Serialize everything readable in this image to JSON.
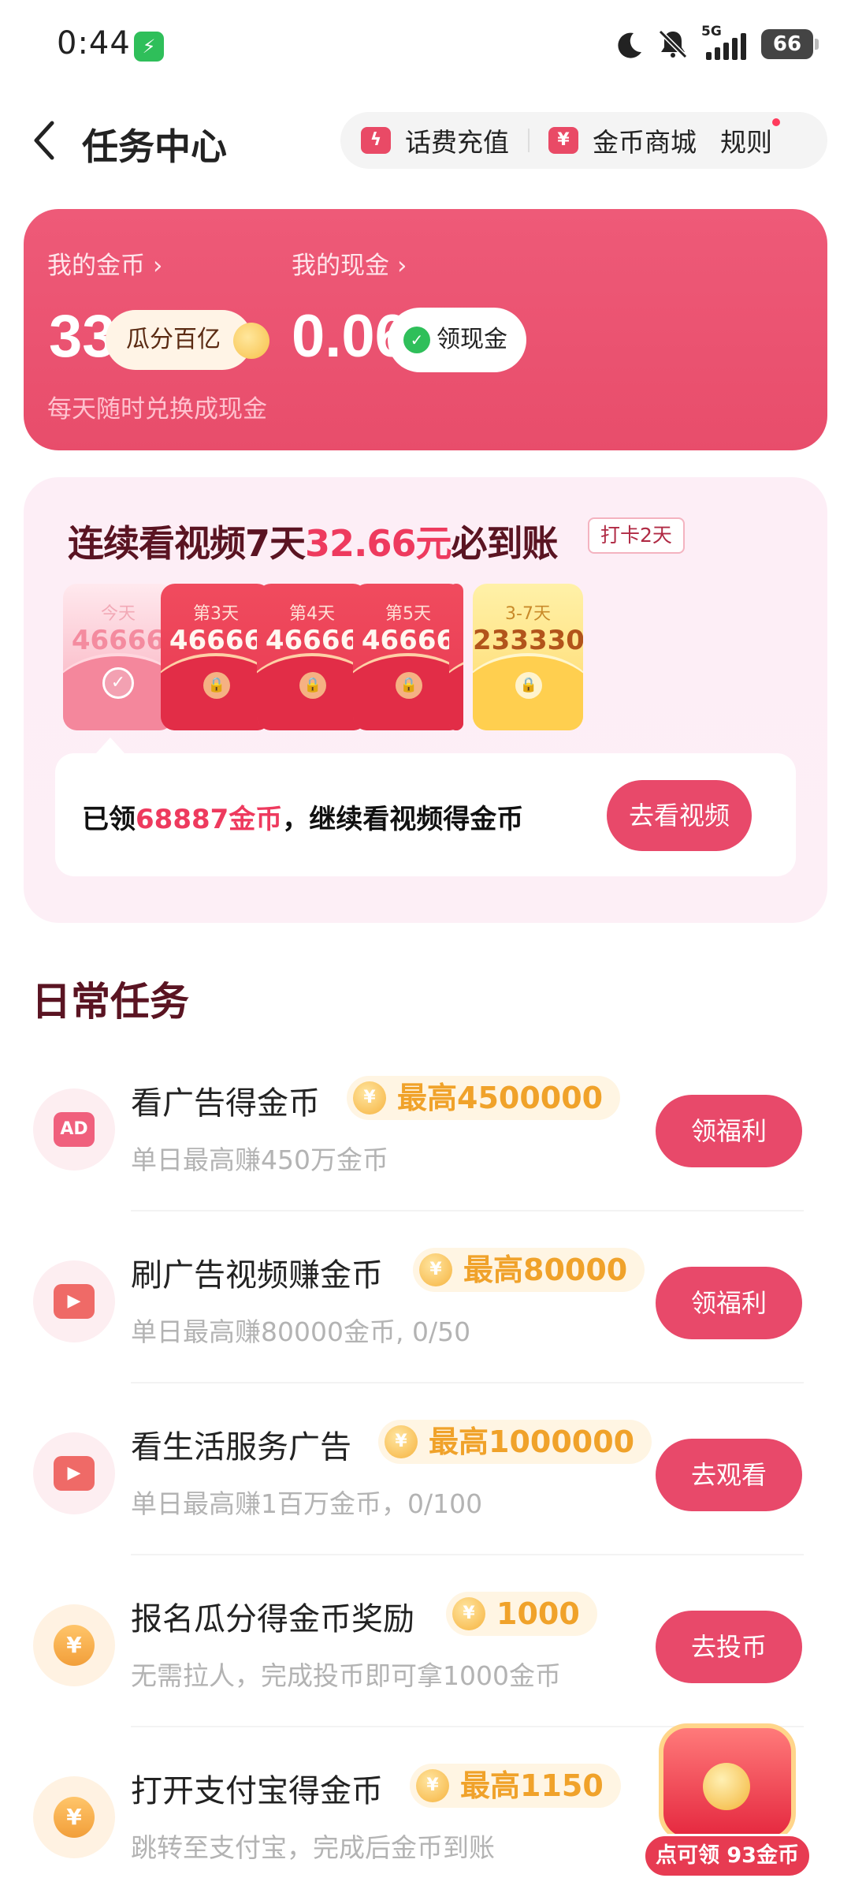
{
  "status": {
    "time": "0:44",
    "network": "5G",
    "battery": "66"
  },
  "header": {
    "title": "任务中心",
    "recharge_label": "话费充值",
    "mall_label": "金币商城",
    "rules_label": "规则"
  },
  "wallet": {
    "coins_label": "我的金币",
    "coins_value": "33",
    "split_badge": "瓜分百亿",
    "hint": "每天随时兑换成现金",
    "cash_label": "我的现金",
    "cash_value": "0.06",
    "cash_button": "领现金"
  },
  "streak": {
    "title_prefix": "连续看视频7天",
    "title_amount": "32.66元",
    "title_suffix": "必到账",
    "tag": "打卡2天",
    "envelopes": [
      {
        "day": "今天",
        "amount": "46666",
        "state": "claimed"
      },
      {
        "day": "第3天",
        "amount": "46666",
        "state": "locked"
      },
      {
        "day": "第4天",
        "amount": "46666",
        "state": "locked"
      },
      {
        "day": "第5天",
        "amount": "46666",
        "state": "locked"
      },
      {
        "day": "3-7天",
        "amount": "233330",
        "state": "locked"
      }
    ],
    "msg_prefix": "已领",
    "msg_amount": "68887金币",
    "msg_suffix": "，继续看视频得金币",
    "button": "去看视频"
  },
  "daily": {
    "title": "日常任务",
    "tasks": [
      {
        "name": "看广告得金币",
        "reward": "最高4500000",
        "desc": "单日最高赚450万金币",
        "button": "领福利",
        "icon": "ad-icon",
        "icon_color": "#f0607d"
      },
      {
        "name": "刷广告视频赚金币",
        "reward": "最高80000",
        "desc": "单日最高赚80000金币, 0/50",
        "button": "领福利",
        "icon": "video-icon",
        "icon_color": "#ef6a67"
      },
      {
        "name": "看生活服务广告",
        "reward": "最高1000000",
        "desc": "单日最高赚1百万金币，0/100",
        "button": "去观看",
        "icon": "play-icon",
        "icon_color": "#ef6a67"
      },
      {
        "name": "报名瓜分得金币奖励",
        "reward": "1000",
        "desc": "无需拉人，完成投币即可拿1000金币",
        "button": "去投币",
        "icon": "yuan-coin-icon",
        "icon_color": "#f5a63e"
      },
      {
        "name": "打开支付宝得金币",
        "reward": "最高1150",
        "desc": "跳转至支付宝，完成后金币到账",
        "button": "",
        "icon": "yuan-coin-icon",
        "icon_color": "#f5a63e"
      }
    ]
  },
  "float_gift": {
    "label": "点可领 93金币"
  }
}
